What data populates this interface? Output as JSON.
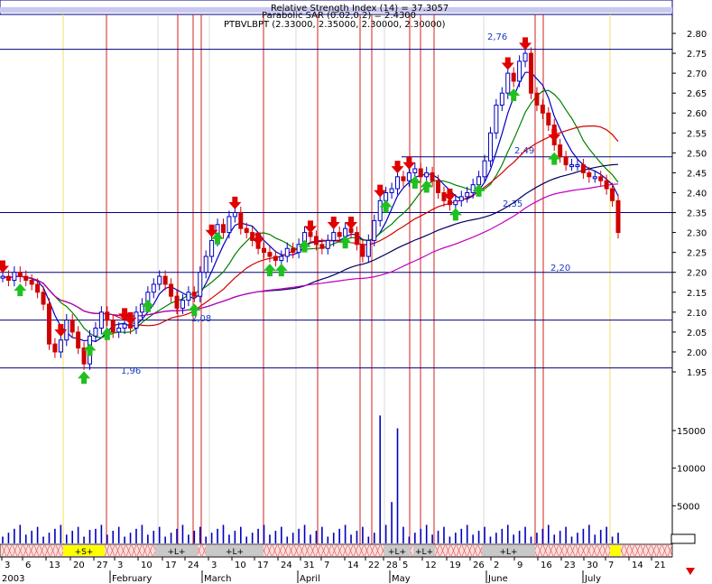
{
  "chart_data": {
    "type": "line",
    "title": "PTBVLBPT (2.33000, 2.35000, 2.30000, 2.30000)",
    "header_overlay": [
      "Relative Strength Index (14) = 37.3057",
      "Parabolic SAR (0.02,0.2) = 2.4300"
    ],
    "price_ticks": [
      {
        "v": 2.8,
        "label": "2.80"
      },
      {
        "v": 2.75,
        "label": "2.75"
      },
      {
        "v": 2.7,
        "label": "2.70"
      },
      {
        "v": 2.65,
        "label": "2.65"
      },
      {
        "v": 2.6,
        "label": "2.60"
      },
      {
        "v": 2.55,
        "label": "2.55"
      },
      {
        "v": 2.5,
        "label": "2.50"
      },
      {
        "v": 2.45,
        "label": "2.45"
      },
      {
        "v": 2.4,
        "label": "2.40"
      },
      {
        "v": 2.35,
        "label": "2.35"
      },
      {
        "v": 2.3,
        "label": "2.30"
      },
      {
        "v": 2.25,
        "label": "2.25"
      },
      {
        "v": 2.2,
        "label": "2.20"
      },
      {
        "v": 2.15,
        "label": "2.15"
      },
      {
        "v": 2.1,
        "label": "2.10"
      },
      {
        "v": 2.05,
        "label": "2.05"
      },
      {
        "v": 2.0,
        "label": "2.00"
      },
      {
        "v": 1.95,
        "label": "1.95"
      }
    ],
    "volume_ticks": [
      {
        "v": 15000,
        "label": "15000"
      },
      {
        "v": 10000,
        "label": "10000"
      },
      {
        "v": 5000,
        "label": "5000"
      }
    ],
    "price_ylim": [
      1.95,
      2.8
    ],
    "volume_ylim": [
      0,
      15000
    ],
    "support_resistance_levels": [
      {
        "value": 2.76,
        "label": "2,76"
      },
      {
        "value": 2.49,
        "label": "2,49"
      },
      {
        "value": 2.35,
        "label": "2,35"
      },
      {
        "value": 2.2,
        "label": "2,20"
      },
      {
        "value": 2.08,
        "label": "2,08"
      },
      {
        "value": 1.96,
        "label": "1,96"
      }
    ],
    "xaxis": {
      "year_label": "2003",
      "day_ticks": [
        "3",
        "6",
        "13",
        "20",
        "27",
        "3",
        "10",
        "17",
        "24",
        "3",
        "10",
        "17",
        "24",
        "31",
        "7",
        "14",
        "22",
        "28",
        "5",
        "12",
        "19",
        "26",
        "2",
        "9",
        "16",
        "23",
        "30",
        "7",
        "14",
        "21"
      ],
      "month_labels": [
        "February",
        "March",
        "April",
        "May",
        "June",
        "July"
      ]
    },
    "signal_labels": [
      "+S+",
      "+L+",
      "+L+",
      "+L+",
      "+L+",
      "+L+"
    ],
    "series": [
      {
        "name": "PTBVLBPT",
        "close": [
          2.19,
          2.18,
          2.2,
          2.19,
          2.18,
          2.17,
          2.15,
          2.12,
          2.02,
          2.0,
          2.03,
          2.08,
          2.05,
          2.01,
          1.97,
          2.04,
          2.06,
          2.1,
          2.08,
          2.05,
          2.06,
          2.07,
          2.06,
          2.1,
          2.12,
          2.15,
          2.17,
          2.19,
          2.17,
          2.14,
          2.11,
          2.13,
          2.15,
          2.14,
          2.2,
          2.24,
          2.28,
          2.32,
          2.3,
          2.34,
          2.35,
          2.31,
          2.3,
          2.28,
          2.26,
          2.25,
          2.24,
          2.23,
          2.24,
          2.26,
          2.25,
          2.27,
          2.3,
          2.29,
          2.27,
          2.26,
          2.28,
          2.3,
          2.29,
          2.31,
          2.3,
          2.27,
          2.24,
          2.28,
          2.33,
          2.38,
          2.4,
          2.41,
          2.44,
          2.43,
          2.45,
          2.46,
          2.44,
          2.45,
          2.43,
          2.4,
          2.38,
          2.37,
          2.38,
          2.39,
          2.4,
          2.42,
          2.44,
          2.48,
          2.55,
          2.62,
          2.65,
          2.7,
          2.68,
          2.73,
          2.75,
          2.65,
          2.62,
          2.6,
          2.57,
          2.52,
          2.49,
          2.47,
          2.47,
          2.47,
          2.45,
          2.44,
          2.44,
          2.43,
          2.41,
          2.38,
          2.3
        ]
      }
    ]
  }
}
